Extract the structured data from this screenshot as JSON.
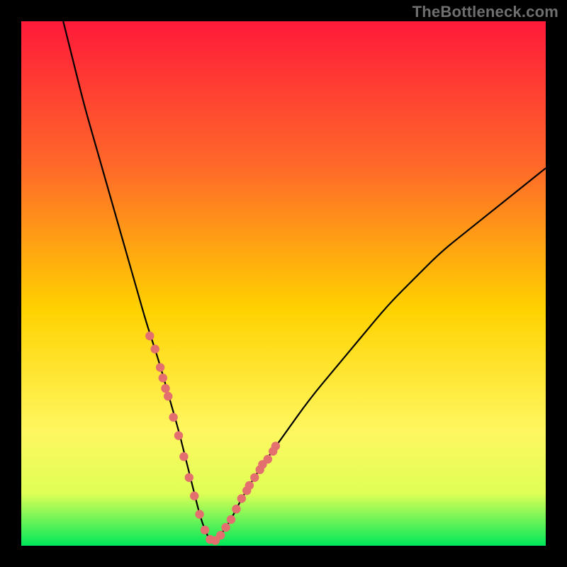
{
  "watermark": "TheBottleneck.com",
  "colors": {
    "frame": "#000000",
    "gradient_top": "#ff1a3a",
    "gradient_mid_upper": "#ff6a29",
    "gradient_mid": "#ffd200",
    "gradient_mid_lower": "#fff760",
    "gradient_lower": "#dfff55",
    "gradient_bottom": "#00e85a",
    "curve": "#000000",
    "dot_fill": "#e36f6f",
    "dot_stroke": "#c94f4f"
  },
  "chart_data": {
    "type": "line",
    "title": "",
    "xlabel": "",
    "ylabel": "",
    "xlim": [
      0,
      100
    ],
    "ylim": [
      0,
      100
    ],
    "grid": false,
    "legend": false,
    "series": [
      {
        "name": "bottleneck_curve",
        "x": [
          8,
          10,
          12,
          14,
          16,
          18,
          20,
          22,
          24,
          26,
          28,
          30,
          31,
          32,
          33,
          34,
          35,
          36,
          37,
          38,
          40,
          42,
          45,
          50,
          55,
          60,
          65,
          70,
          75,
          80,
          85,
          90,
          95,
          100
        ],
        "y": [
          100,
          92,
          84,
          77,
          70,
          63,
          56,
          49,
          42,
          36,
          29,
          22,
          18,
          14,
          10,
          6,
          3,
          1,
          1,
          2,
          5,
          9,
          14,
          21,
          28,
          34,
          40,
          46,
          51,
          56,
          60,
          64,
          68,
          72
        ]
      }
    ],
    "highlight_points": {
      "name": "scatter_on_curve",
      "x": [
        24.5,
        25.5,
        26.5,
        27,
        27.5,
        28,
        29,
        30,
        31,
        32,
        33,
        34,
        35,
        36,
        37,
        38,
        39,
        40,
        41,
        42,
        43,
        43.5,
        44.5,
        45.5,
        46,
        47,
        48,
        48.5
      ],
      "y": [
        40,
        37.5,
        34,
        32,
        30,
        28.5,
        24.5,
        21,
        17,
        13,
        9.5,
        6,
        3,
        1.2,
        1,
        2,
        3.5,
        5,
        7,
        9,
        10.5,
        11.5,
        13,
        14.5,
        15.5,
        16.5,
        18,
        19
      ]
    }
  }
}
